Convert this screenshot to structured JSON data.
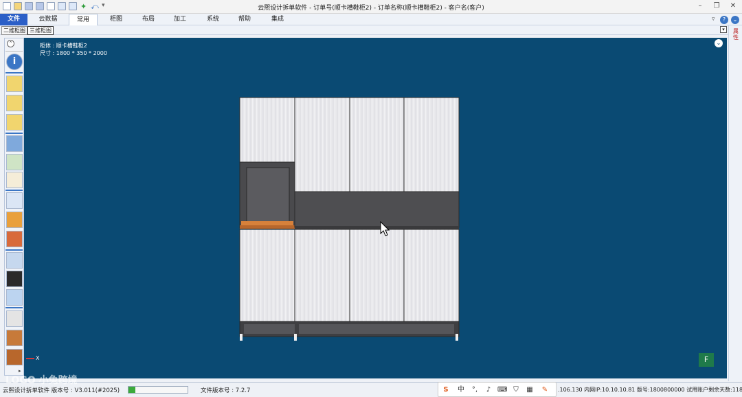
{
  "titlebar": {
    "title": "云熙设计拆单软件 - 订单号(顺卡槽鞋柜2) - 订单名称(顺卡槽鞋柜2) - 客户名(客户)"
  },
  "ribbon": {
    "tabs": [
      "文件",
      "云数据",
      "常用",
      "柜图",
      "布局",
      "加工",
      "系统",
      "帮助",
      "集成"
    ],
    "active_index": 2
  },
  "view_tabs": [
    "二维柜图",
    "三维柜图"
  ],
  "right_strip_label": "属性",
  "viewport": {
    "name_line": "柜体 : 顺卡槽鞋柜2",
    "size_line": "尺寸 : 1800 * 350 * 2000",
    "axis_label": "X",
    "corner_badge": "F",
    "bg_color": "#0a4a73"
  },
  "status": {
    "left_text": "云熙设计拆单软件 版本号 : V3.011(#2025)",
    "file_version": "文件版本号 : 7.2.7",
    "network": ".106.130 内网IP:10.10.10.81 版号:1800800000 试用账户剩余天数:118",
    "watermark": "LOGO 小兔跨境"
  },
  "tray": {
    "icons": [
      "sogou-icon",
      "中",
      "°,",
      "mic-icon",
      "keyboard-icon",
      "shirt-icon",
      "grid-icon",
      "tool-icon"
    ]
  }
}
